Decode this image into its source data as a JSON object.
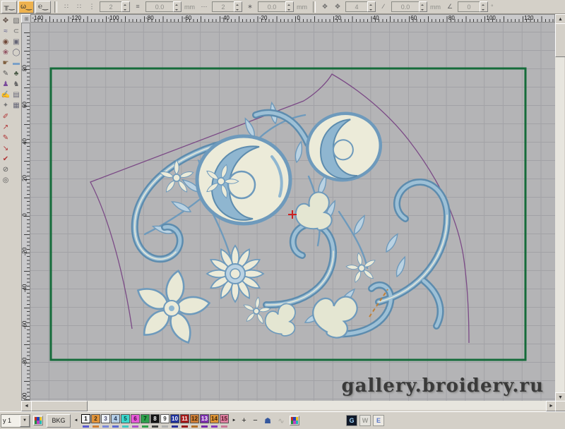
{
  "colors": {
    "window_bg": "#d4d0c8",
    "canvas_bg": "#b4b4b6",
    "grid_line": "#a2a2a6",
    "hoop_green": "#156b3a",
    "outline_purple": "#7b4a86",
    "design_blue": "#6e9abc",
    "design_light_blue": "#bad2e2",
    "design_cream": "#ecebd9",
    "cursor_red": "#cc2222",
    "guide_orange": "#c08038",
    "mini_palette": [
      "#c03020",
      "#2040c0",
      "#e8c020",
      "#209040",
      "#c040c0",
      "#20b8b8"
    ]
  },
  "top_toolbar": {
    "stitch_buttons": [
      {
        "name": "running-stitch-button",
        "glyph": "╥‿",
        "active": false
      },
      {
        "name": "zigzag-stitch-button",
        "glyph": "ω‿",
        "active": true
      },
      {
        "name": "satin-stitch-button",
        "glyph": "℮‿",
        "active": false
      }
    ],
    "small_icons": [
      {
        "name": "pattern-dots-icon",
        "glyph": "∷"
      },
      {
        "name": "pattern-dots2-icon",
        "glyph": "∷"
      },
      {
        "name": "column-dots-icon",
        "glyph": "⋮"
      }
    ],
    "fields": [
      {
        "value": "2",
        "unit": ""
      },
      {
        "value": "0.0",
        "unit": "mm"
      },
      {
        "value": "2",
        "unit": ""
      },
      {
        "value": "0.0",
        "unit": "mm"
      },
      {
        "value": "4",
        "unit": ""
      },
      {
        "value": "0.0",
        "unit": "mm"
      },
      {
        "value": "0",
        "unit": "°"
      }
    ],
    "mid_icons": {
      "density": "≡",
      "ellipsis": "···",
      "percent": "∗",
      "move1": "✥",
      "move2": "✥",
      "slash": "∕",
      "angle": "∠"
    }
  },
  "left_toolbar": {
    "grid": [
      {
        "name": "reshape-tool-icon",
        "glyph": "✥",
        "color": "#5a4a42"
      },
      {
        "name": "hatch-fill-icon",
        "glyph": "▨",
        "color": "#6a6a6a"
      },
      {
        "name": "curve-tool-icon",
        "glyph": "≈",
        "color": "#5a5a8a"
      },
      {
        "name": "arc-tool-icon",
        "glyph": "⊂",
        "color": "#666666"
      },
      {
        "name": "eye-tool-icon",
        "glyph": "◉",
        "color": "#704838"
      },
      {
        "name": "portrait-image-icon",
        "glyph": "▣",
        "color": "#666677"
      },
      {
        "name": "flower-motif-icon",
        "glyph": "❀",
        "color": "#905060"
      },
      {
        "name": "ellipse-shape-icon",
        "glyph": "◯",
        "color": "#666677"
      },
      {
        "name": "hand-tool-icon",
        "glyph": "☛",
        "color": "#806040"
      },
      {
        "name": "rect-shape-icon",
        "glyph": "▬",
        "color": "#7aa0c8"
      },
      {
        "name": "pencil-tool-icon",
        "glyph": "✎",
        "color": "#555555"
      },
      {
        "name": "tree-motif-icon",
        "glyph": "♣",
        "color": "#4a5a46"
      },
      {
        "name": "figure-motif-icon",
        "glyph": "♟",
        "color": "#7a4a9a"
      },
      {
        "name": "people-motif-icon",
        "glyph": "♞",
        "color": "#666666"
      },
      {
        "name": "draw-hand-icon",
        "glyph": "✍",
        "color": "#6a5038"
      },
      {
        "name": "landscape-image-icon",
        "glyph": "▤",
        "color": "#666677"
      },
      {
        "name": "tools-icon",
        "glyph": "✦",
        "color": "#777777"
      },
      {
        "name": "texture-fill-icon",
        "glyph": "▦",
        "color": "#666677"
      }
    ],
    "singles": [
      {
        "name": "stitch-pencil-icon",
        "glyph": "✐",
        "color": "#b03434"
      },
      {
        "name": "stitch-arrow-icon",
        "glyph": "↗",
        "color": "#b03434"
      },
      {
        "name": "stitch-edit-icon",
        "glyph": "✎",
        "color": "#b03434"
      },
      {
        "name": "stitch-insert-icon",
        "glyph": "↘",
        "color": "#b03434"
      },
      {
        "name": "stitch-check-icon",
        "glyph": "✔",
        "color": "#b03434"
      },
      {
        "name": "disable-icon",
        "glyph": "⊘",
        "color": "#555555"
      },
      {
        "name": "target-icon",
        "glyph": "◎",
        "color": "#555555"
      }
    ]
  },
  "rulers": {
    "horizontal": {
      "labels": [
        "-140",
        "-120",
        "-100",
        "-80",
        "-60",
        "-40",
        "-20",
        "0",
        "20",
        "40",
        "60",
        "80",
        "100",
        "120"
      ]
    },
    "vertical": {
      "labels": [
        "80",
        "60",
        "40",
        "20",
        "0",
        "-20",
        "-40",
        "-60",
        "-80",
        "-100"
      ]
    }
  },
  "canvas": {
    "watermark": "gallery.broidery.ru"
  },
  "scroll": {
    "up": "▲",
    "down": "▼",
    "left": "◄",
    "right": "►"
  },
  "bottom_bar": {
    "layer_select_value": "y 1",
    "bkg_label": "BKG",
    "prev_arrow": "◄",
    "next_arrow": "►",
    "zoom_plus": "+",
    "zoom_minus": "−",
    "bucket_icon": "☗",
    "disabled_icon": "∿",
    "palette": [
      {
        "num": "1",
        "bg": "#f4f4f4",
        "fg": "#000000",
        "mark": "#5a5ad0",
        "selected": true
      },
      {
        "num": "2",
        "bg": "#e2943a",
        "fg": "#3a2a10",
        "mark": "#d08030",
        "selected": false
      },
      {
        "num": "3",
        "bg": "#eef2f8",
        "fg": "#444466",
        "mark": "#7a88d8",
        "selected": false
      },
      {
        "num": "4",
        "bg": "#b4cee6",
        "fg": "#223355",
        "mark": "#5a6ad0",
        "selected": false
      },
      {
        "num": "5",
        "bg": "#3cd8cc",
        "fg": "#064444",
        "mark": "#40c8c0",
        "selected": false
      },
      {
        "num": "6",
        "bg": "#e85ad8",
        "fg": "#440044",
        "mark": "#b050c8",
        "selected": false
      },
      {
        "num": "7",
        "bg": "#2ea04c",
        "fg": "#04300c",
        "mark": "#30a048",
        "selected": false
      },
      {
        "num": "8",
        "bg": "#141414",
        "fg": "#ffffff",
        "mark": "#404040",
        "selected": false
      },
      {
        "num": "9",
        "bg": "#fdfdfd",
        "fg": "#333333",
        "mark": "#b0b0b0",
        "selected": false
      },
      {
        "num": "10",
        "bg": "#20339e",
        "fg": "#ffffff",
        "mark": "#283098",
        "selected": false
      },
      {
        "num": "11",
        "bg": "#a61a1a",
        "fg": "#ffffff",
        "mark": "#981818",
        "selected": false
      },
      {
        "num": "12",
        "bg": "#cd7d35",
        "fg": "#3a2408",
        "mark": "#b07028",
        "selected": false
      },
      {
        "num": "13",
        "bg": "#7e2fae",
        "fg": "#ffffff",
        "mark": "#7828a8",
        "selected": false
      },
      {
        "num": "14",
        "bg": "#df9434",
        "fg": "#3a2408",
        "mark": "#8838b8",
        "selected": false
      },
      {
        "num": "15",
        "bg": "#df7fa0",
        "fg": "#4a1020",
        "mark": "#c87898",
        "selected": false
      }
    ],
    "taskbar_icons": [
      {
        "name": "app-icon-g",
        "glyph": "G",
        "bg": "#101828",
        "fg": "#9fd8ff"
      },
      {
        "name": "app-icon-w",
        "glyph": "W",
        "bg": "#e4e2dc",
        "fg": "#9a9a94"
      },
      {
        "name": "app-icon-e",
        "glyph": "E",
        "bg": "#ece9e2",
        "fg": "#5a78c8"
      }
    ]
  }
}
